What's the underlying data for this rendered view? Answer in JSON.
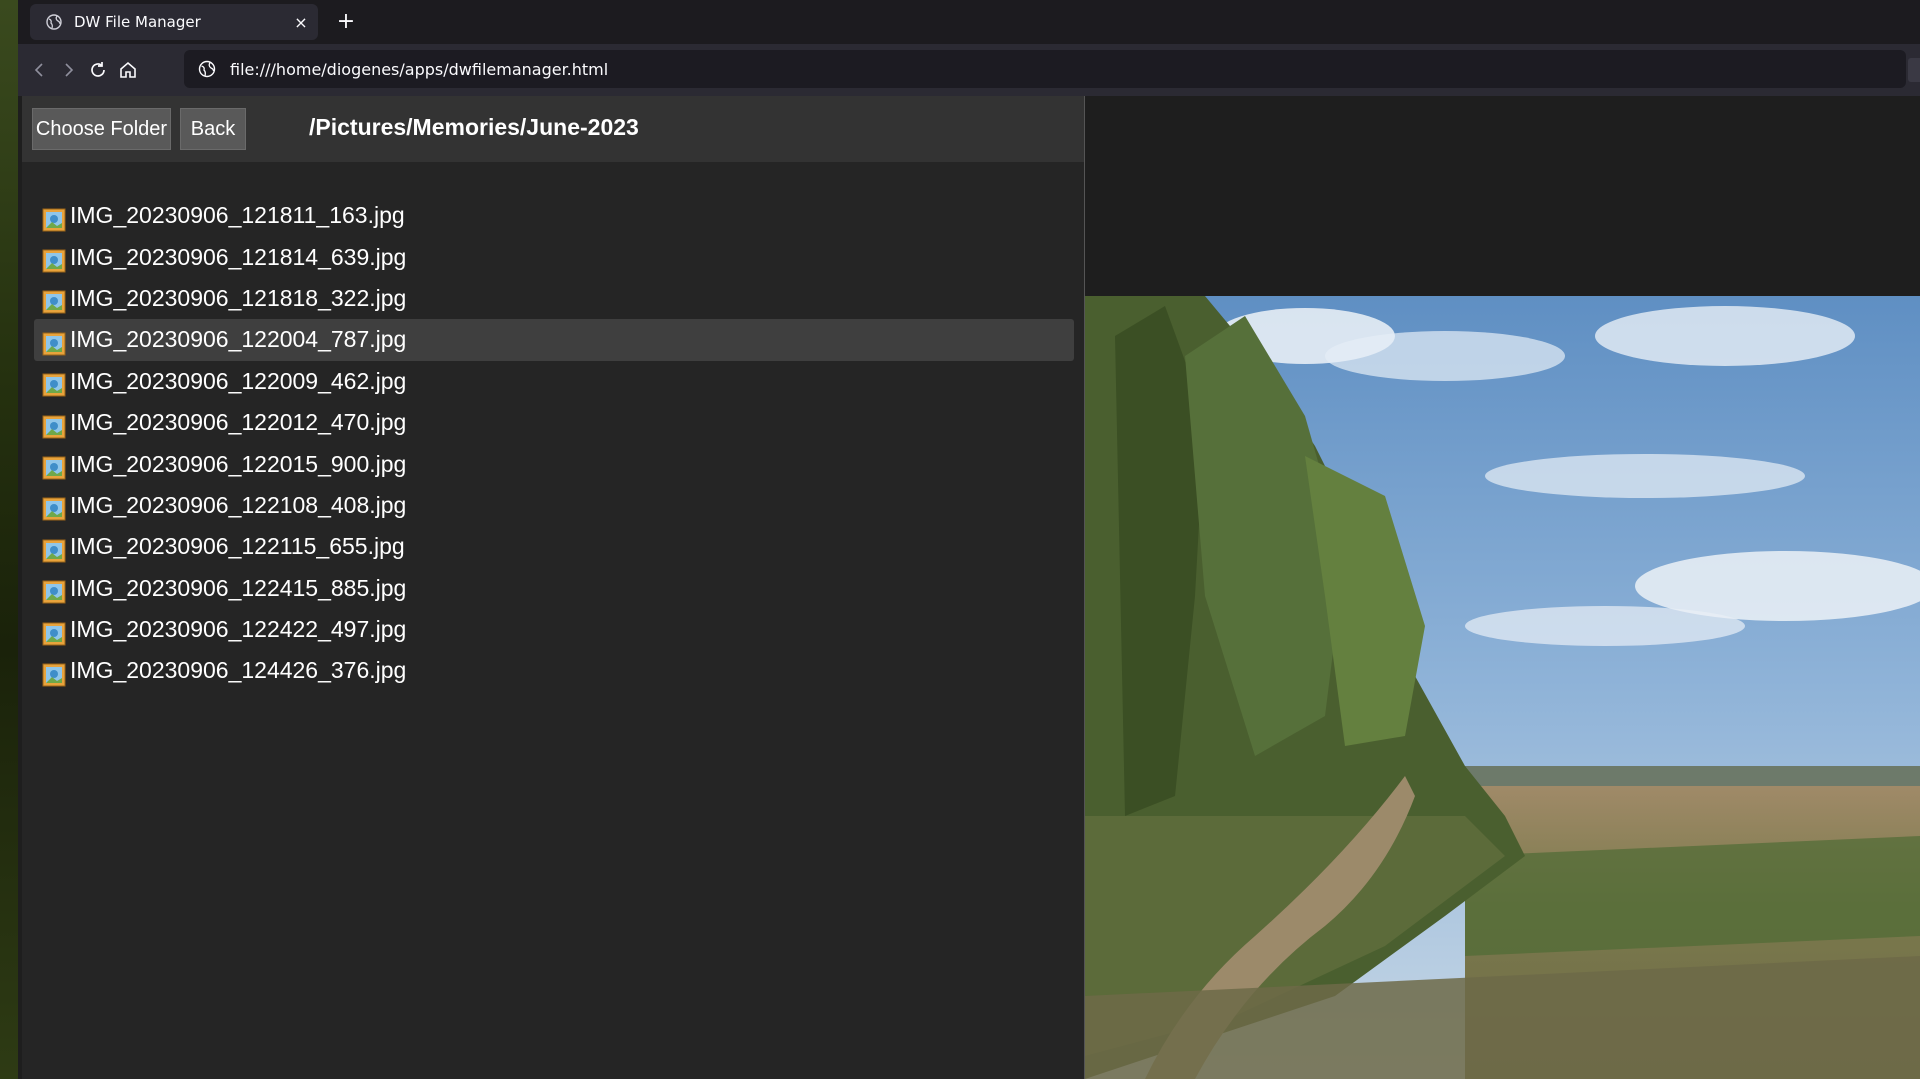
{
  "browser": {
    "tab_title": "DW File Manager",
    "tab_close": "×",
    "new_tab": "+",
    "url": "file:///home/diogenes/apps/dwfilemanager.html"
  },
  "toolbar": {
    "choose_folder_label": "Choose Folder",
    "back_label": "Back",
    "path": "/Pictures/Memories/June-2023"
  },
  "files": [
    {
      "name": "IMG_20230906_121811_163.jpg"
    },
    {
      "name": "IMG_20230906_121814_639.jpg"
    },
    {
      "name": "IMG_20230906_121818_322.jpg"
    },
    {
      "name": "IMG_20230906_122004_787.jpg",
      "selected": true
    },
    {
      "name": "IMG_20230906_122009_462.jpg"
    },
    {
      "name": "IMG_20230906_122012_470.jpg"
    },
    {
      "name": "IMG_20230906_122015_900.jpg"
    },
    {
      "name": "IMG_20230906_122108_408.jpg"
    },
    {
      "name": "IMG_20230906_122115_655.jpg"
    },
    {
      "name": "IMG_20230906_122415_885.jpg"
    },
    {
      "name": "IMG_20230906_122422_497.jpg"
    },
    {
      "name": "IMG_20230906_124426_376.jpg"
    }
  ],
  "icons": {
    "file": "image-file-icon",
    "tab": "globe-icon",
    "site": "site-info-icon"
  },
  "colors": {
    "selected_row": "#3f3f3f",
    "button_bg": "#595959",
    "toolbar_bg": "#333333"
  }
}
